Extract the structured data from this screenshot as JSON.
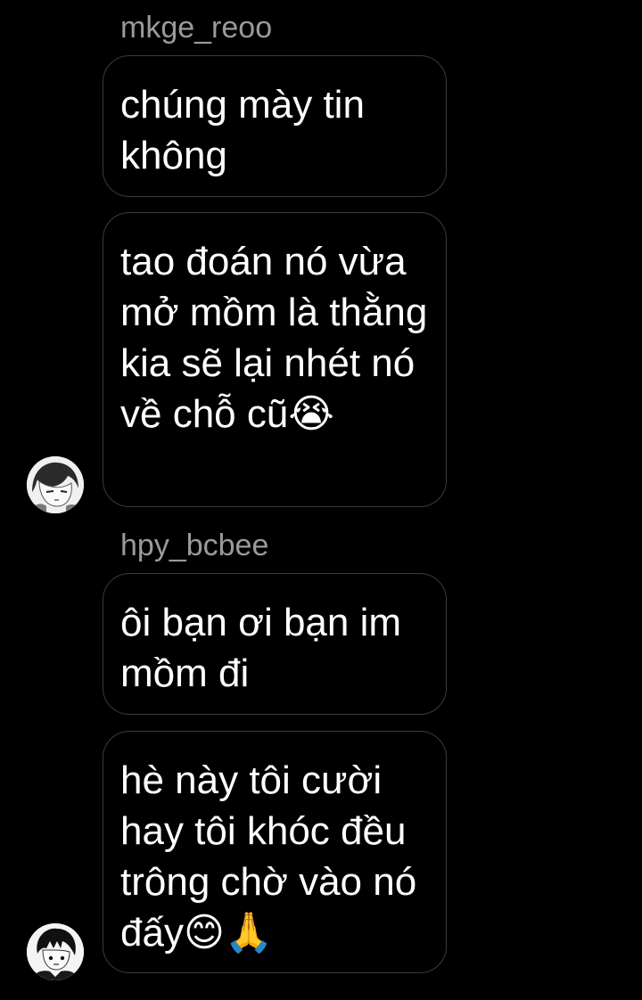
{
  "theme": {
    "background": "#000000",
    "bubble_border": "#3b3b3b",
    "sender_color": "#9a9a9a",
    "text_color": "#ffffff"
  },
  "groups": [
    {
      "sender": "mkge_reoo",
      "avatar_icon": "anime-girl-avatar-icon",
      "messages": [
        "chúng mày tin không",
        "tao đoán nó vừa mở mồm là thằng kia sẽ lại nhét nó về chỗ cũ😭"
      ]
    },
    {
      "sender": "hpy_bcbee",
      "avatar_icon": "anime-boy-avatar-icon",
      "messages": [
        "ôi bạn ơi bạn im mồm đi",
        "hè này tôi cười hay tôi khóc đều trông chờ vào nó đấy😊🙏"
      ]
    }
  ]
}
